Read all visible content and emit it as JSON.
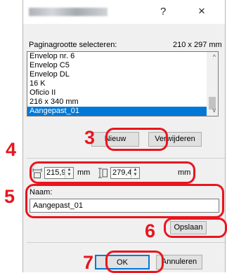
{
  "window": {
    "help_label": "?",
    "close_label": "×"
  },
  "paper_size": {
    "label": "Paginagrootte selecteren:",
    "value": "210 x 297 mm"
  },
  "list": {
    "items": [
      "Envelop nr. 6",
      "Envelop C5",
      "Envelop DL",
      "16 K",
      "Oficio II",
      "216 x 340 mm",
      "Aangepast_01"
    ],
    "selected_index": 6,
    "scroll_up": "^",
    "scroll_down": "v"
  },
  "buttons": {
    "new": "Nieuw",
    "delete": "Verwijderen",
    "save": "Opslaan",
    "ok": "OK",
    "cancel": "Annuleren"
  },
  "dimensions": {
    "width_value": "215,9",
    "width_unit": "mm",
    "height_value": "279,4",
    "height_unit": "mm"
  },
  "name": {
    "label": "Naam:",
    "value": "Aangepast_01"
  },
  "callouts": {
    "n3": "3",
    "n4": "4",
    "n5": "5",
    "n6": "6",
    "n7": "7"
  },
  "colors": {
    "callout": "#e8161e",
    "selection": "#0078d7"
  }
}
